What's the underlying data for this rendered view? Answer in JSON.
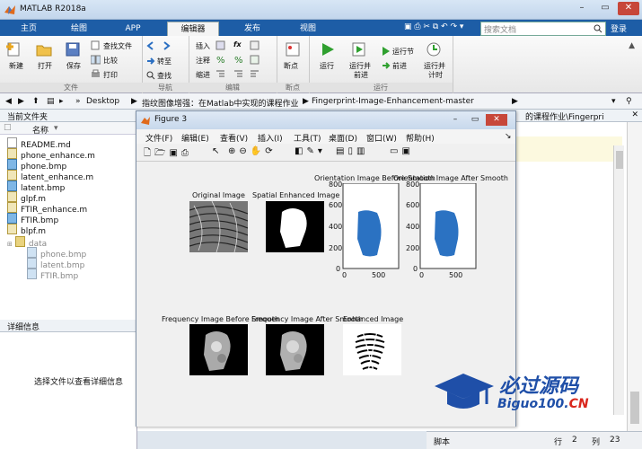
{
  "window": {
    "title": "MATLAB R2018a"
  },
  "tabs": [
    "主页",
    "绘图",
    "APP",
    "编辑器",
    "发布",
    "视图"
  ],
  "search": {
    "placeholder": "搜索文档",
    "login": "登录"
  },
  "ribbon": {
    "file": {
      "new": "新建",
      "open": "打开",
      "save": "保存",
      "find_files": "查找文件",
      "compare": "比较",
      "print": "打印",
      "caption": "文件"
    },
    "nav": {
      "goto": "转至",
      "find": "查找",
      "caption": "导航"
    },
    "edit": {
      "insert": "插入",
      "comment": "注释",
      "indent": "缩进",
      "fx": "fx",
      "caption": "编辑"
    },
    "breakpoints": {
      "label": "断点",
      "caption": "断点"
    },
    "run": {
      "run": "运行",
      "run_advance_l1": "运行并",
      "run_advance_l2": "前进",
      "run_section": "运行节",
      "advance": "前进",
      "run_time_l1": "运行并",
      "run_time_l2": "计时",
      "caption": "运行"
    }
  },
  "address": {
    "parts": [
      "Desktop",
      "指纹图像增强：在Matlab中实现的课程作业",
      "Fingerprint-Image-Enhancement-master"
    ]
  },
  "current_folder": {
    "title": "当前文件夹",
    "col_name": "名称",
    "files": [
      "README.md",
      "phone_enhance.m",
      "phone.bmp",
      "latent_enhance.m",
      "latent.bmp",
      "glpf.m",
      "FTIR_enhance.m",
      "FTIR.bmp",
      "blpf.m"
    ],
    "folder": "data",
    "subfiles": [
      "phone.bmp",
      "latent.bmp",
      "FTIR.bmp"
    ]
  },
  "details": {
    "title": "详细信息",
    "hint": "选择文件以查看详细信息"
  },
  "editor": {
    "path_tail": "的课程作业\\Fingerpri"
  },
  "figure": {
    "title": "Figure 3",
    "menu": [
      "文件(F)",
      "编辑(E)",
      "查看(V)",
      "插入(I)",
      "工具(T)",
      "桌面(D)",
      "窗口(W)",
      "帮助(H)"
    ],
    "plots": {
      "original": "Original Image",
      "spatial": "Spatial Enhanced Image",
      "orient_before": "Orientation Image Before Smooth",
      "orient_after": "Orientation Image After Smooth",
      "freq_before": "Frequency Image Before Smooth",
      "freq_after": "Frequency Image After Smooth",
      "enhanced": "Enhanced Image"
    },
    "axes": {
      "y_ticks": [
        "800",
        "600",
        "400",
        "200",
        "0"
      ],
      "x_ticks": [
        "0",
        "500"
      ]
    }
  },
  "watermark": {
    "cn": "必过源码",
    "url": "Biguo100.",
    "cn_suffix": "CN"
  },
  "status": {
    "script": "脚本",
    "row_label": "行",
    "row": "2",
    "col_label": "列",
    "col": "23"
  }
}
